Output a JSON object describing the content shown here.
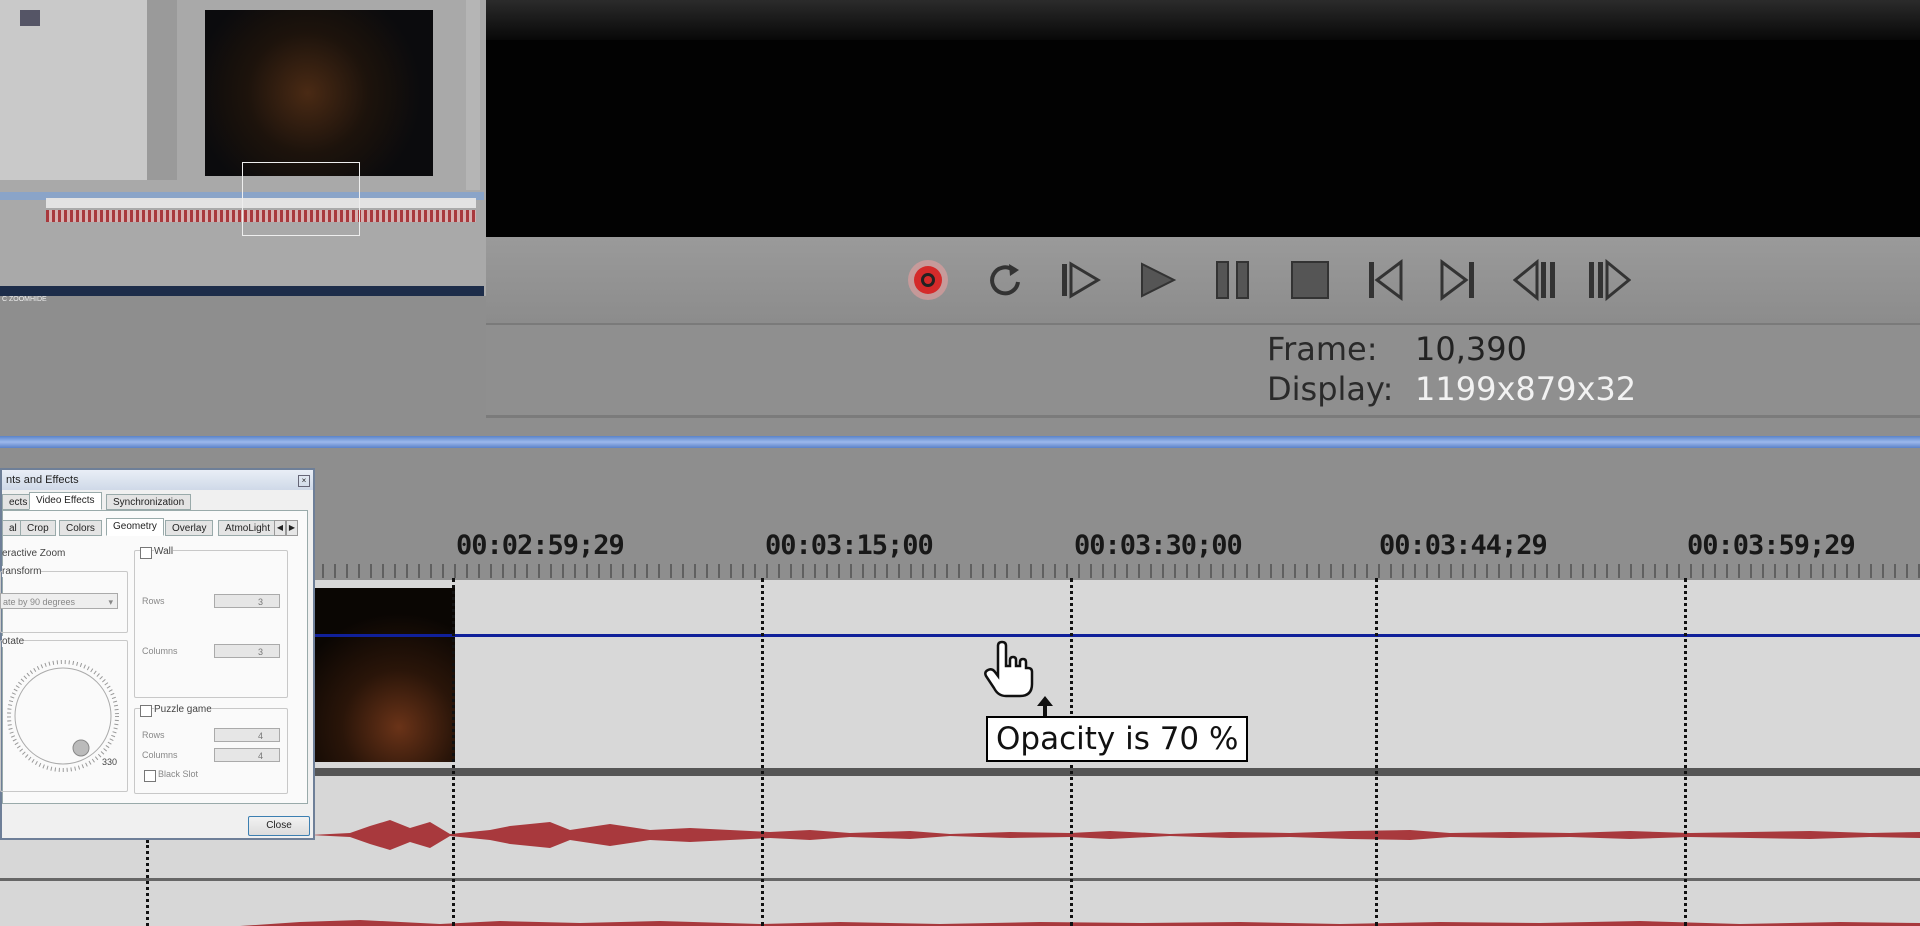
{
  "transport": {
    "buttons": [
      "record",
      "loop",
      "play-from-start",
      "play",
      "pause",
      "stop",
      "go-to-start",
      "go-to-end",
      "previous-frame",
      "next-frame"
    ]
  },
  "status": {
    "frame_label": "Frame:",
    "frame_value": "10,390",
    "display_label": "Display:",
    "display_value": "1199x879x32"
  },
  "timeline": {
    "timecodes": [
      "00:02:59;29",
      "00:03:15;00",
      "00:03:30;00",
      "00:03:44;29",
      "00:03:59;29"
    ],
    "tooltip": "Opacity is 70 %"
  },
  "dialog": {
    "title": "nts and Effects",
    "tabs_top": [
      "ects",
      "Video Effects",
      "Synchronization"
    ],
    "tabs_sub": [
      "al",
      "Crop",
      "Colors",
      "Geometry",
      "Overlay",
      "AtmoLight"
    ],
    "interactive_zoom": "eractive Zoom",
    "transform_label": "ransform",
    "transform_select": "ate by 90 degrees",
    "rotate_label": "otate",
    "rotate_value": "330",
    "wall_label": "Wall",
    "rows_label": "Rows",
    "rows_value": "3",
    "columns_label": "Columns",
    "columns_value": "3",
    "puzzle_label": "Puzzle game",
    "puzzle_rows_label": "Rows",
    "puzzle_rows_value": "4",
    "puzzle_columns_label": "Columns",
    "puzzle_columns_value": "4",
    "black_slot_label": "Black Slot",
    "close_label": "Close"
  },
  "mini_caption": "C ZOOMHIDE",
  "colors": {
    "record_red": "#d42a2a",
    "blue_band": "#7ea2e0",
    "opacity_line": "#10209a",
    "waveform": "#a8393d"
  }
}
